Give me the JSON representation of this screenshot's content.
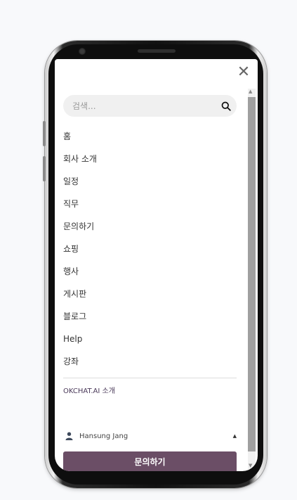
{
  "search": {
    "placeholder": "검색..."
  },
  "menu": {
    "items": [
      {
        "label": "홈"
      },
      {
        "label": "회사 소개"
      },
      {
        "label": "일정"
      },
      {
        "label": "직무"
      },
      {
        "label": "문의하기"
      },
      {
        "label": "쇼핑"
      },
      {
        "label": "행사"
      },
      {
        "label": "게시판"
      },
      {
        "label": "블로그"
      },
      {
        "label": "Help"
      },
      {
        "label": "강좌"
      }
    ]
  },
  "extra_link": "OKCHAT.AI 소개",
  "user": {
    "name": "Hansung Jang"
  },
  "cta": {
    "label": "문의하기"
  },
  "colors": {
    "accent": "#6b4e66",
    "link": "#4b3a5a",
    "scrollbar": "#a0a0a0"
  },
  "icons": [
    "close-icon",
    "search-icon",
    "user-icon",
    "caret-up-icon"
  ]
}
